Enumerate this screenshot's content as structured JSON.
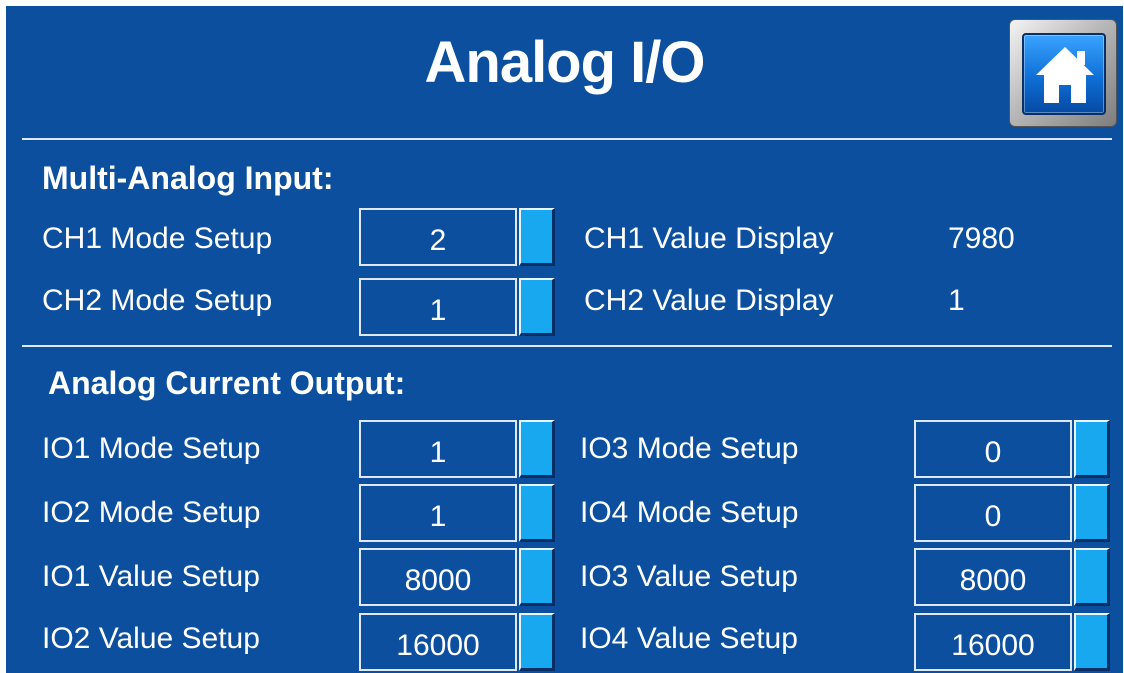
{
  "header": {
    "title": "Analog I/O",
    "home_icon": "home-icon"
  },
  "multi_analog_input": {
    "title": "Multi-Analog Input:",
    "ch1_mode_label": "CH1 Mode Setup",
    "ch1_mode_value": "2",
    "ch2_mode_label": "CH2 Mode Setup",
    "ch2_mode_value": "1",
    "ch1_value_label": "CH1 Value Display",
    "ch1_value": "7980",
    "ch2_value_label": "CH2 Value Display",
    "ch2_value": "1"
  },
  "analog_current_output": {
    "title": "Analog Current Output:",
    "io1_mode_label": "IO1 Mode Setup",
    "io1_mode_value": "1",
    "io2_mode_label": "IO2 Mode Setup",
    "io2_mode_value": "1",
    "io1_value_label": "IO1 Value Setup",
    "io1_value": "8000",
    "io2_value_label": "IO2 Value Setup",
    "io2_value": "16000",
    "io3_mode_label": "IO3 Mode Setup",
    "io3_mode_value": "0",
    "io4_mode_label": "IO4 Mode Setup",
    "io4_mode_value": "0",
    "io3_value_label": "IO3 Value Setup",
    "io3_value": "8000",
    "io4_value_label": "IO4 Value Setup",
    "io4_value": "16000"
  },
  "colors": {
    "background": "#0b4f9e",
    "text": "#ffffff",
    "button": "#17a8ef"
  }
}
